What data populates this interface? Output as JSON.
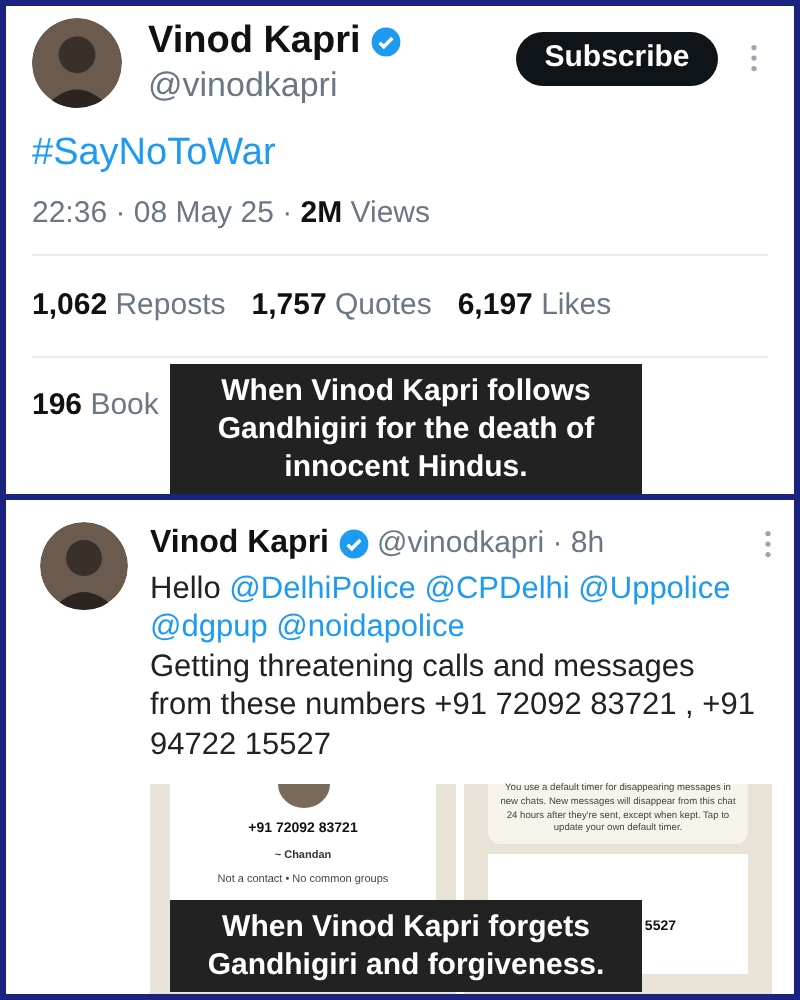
{
  "top_tweet": {
    "name": "Vinod Kapri",
    "verified": true,
    "handle": "@vinodkapri",
    "subscribe_button": "Subscribe",
    "hashtag": "#SayNoToWar",
    "meta": "22:36 · 08 May 25 · **2M** Views",
    "stats": [
      {
        "count": "1,062",
        "label": "Reposts"
      },
      {
        "count": "1,757",
        "label": "Quotes"
      },
      {
        "count": "6,197",
        "label": "Likes"
      },
      {
        "count": "196",
        "label": "Book"
      }
    ],
    "caption": "When Vinod Kapri follows Gandhigiri for the death of innocent Hindus."
  },
  "bottom_tweet": {
    "name": "Vinod Kapri",
    "verified": true,
    "meta": "@vinodkapri · 8h",
    "body": [
      {
        "kind": "text",
        "text": "Hello"
      },
      {
        "kind": "mention",
        "text": "@DelhiPolice"
      },
      {
        "kind": "mention",
        "text": "@CPDelhi"
      },
      {
        "kind": "mention",
        "text": "@Uppolice"
      },
      {
        "kind": "mention",
        "text": "@dgpup"
      },
      {
        "kind": "mention",
        "text": "@noidapolice"
      },
      {
        "kind": "break",
        "text": "Getting threatening calls and messages from these numbers +91 72092 83721 , +91 94722 15527"
      }
    ],
    "left_shot": {
      "phone": "+91 72092 83721",
      "contact_name": "~ Chandan",
      "info": "Not a contact • No common groups"
    },
    "right_shot": {
      "notice": "You use a default timer for disappearing messages in new chats. New messages will disappear from this chat 24 hours after they're sent, except when kept. Tap to update your own default timer.",
      "number_fragment": "5527"
    },
    "caption": "When Vinod Kapri forgets Gandhigiri and forgiveness."
  }
}
